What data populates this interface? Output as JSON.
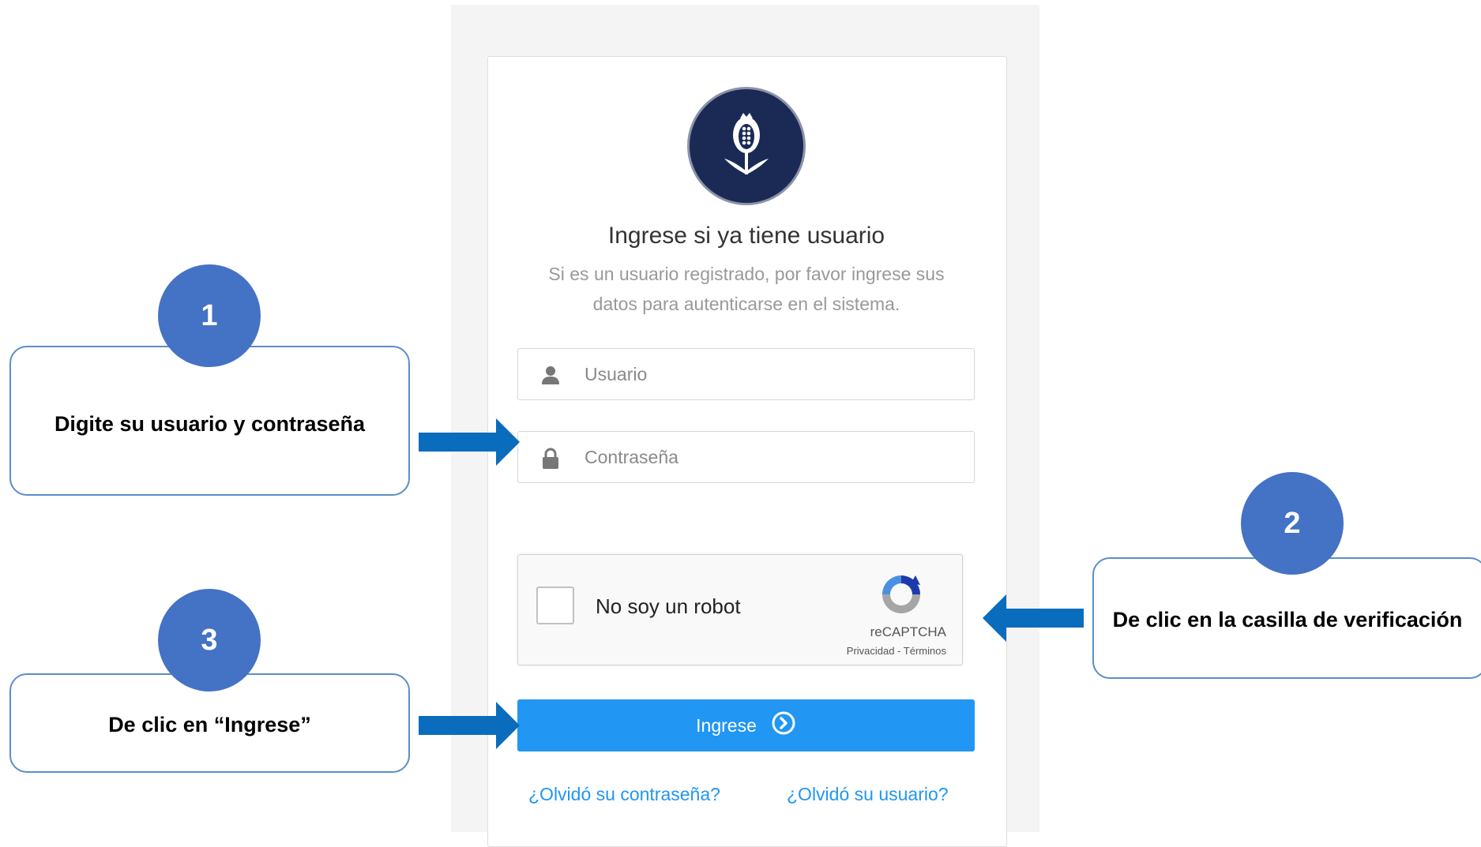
{
  "login": {
    "title": "Ingrese si ya tiene usuario",
    "subtitle_line1": "Si es un usuario registrado, por favor ingrese sus",
    "subtitle_line2": "datos para autenticarse en el sistema.",
    "username_placeholder": "Usuario",
    "password_placeholder": "Contraseña",
    "captcha_label": "No soy un robot",
    "captcha_brand": "reCAPTCHA",
    "captcha_links": "Privacidad - Términos",
    "submit_label": "Ingrese",
    "forgot_password": "¿Olvidó su contraseña?",
    "forgot_username": "¿Olvidó su usuario?"
  },
  "annotations": {
    "step1_number": "1",
    "step1_text": "Digite su usuario y contraseña",
    "step2_number": "2",
    "step2_text": "De clic en la casilla de verificación",
    "step3_number": "3",
    "step3_text": "De clic en “Ingrese”"
  },
  "colors": {
    "primary_button": "#2196f3",
    "logo_background": "#1b2a55",
    "annotation_badge": "#4472c4",
    "annotation_arrow": "#0a6cbc",
    "panel_background": "#f4f4f4"
  },
  "icons": [
    "logo-emblem-icon",
    "user-icon",
    "lock-icon",
    "recaptcha-icon",
    "arrow-circle-right-icon"
  ]
}
